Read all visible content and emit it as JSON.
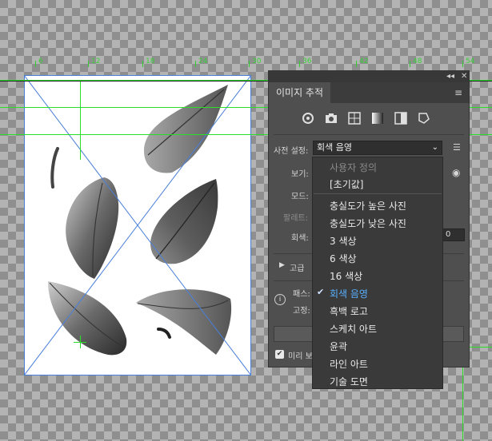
{
  "ruler": {
    "labels": [
      "6",
      "12",
      "18",
      "24",
      "30",
      "36",
      "42",
      "48",
      "54"
    ]
  },
  "panel": {
    "tab_title": "이미지 추적",
    "collapse_label": "◂◂",
    "close_label": "✕",
    "preset_label": "사전 설정:",
    "preset_value": "회색 음영",
    "view_label": "보기:",
    "mode_label": "모드:",
    "palette_label": "팔레트:",
    "grays_label": "회색:",
    "grays_value": "0",
    "advanced_label": "고급",
    "paths_label": "패스:",
    "fixed_label": "고정:",
    "preview_label": "미리 보기"
  },
  "dropdown": {
    "items": [
      {
        "label": "사용자 정의",
        "state": "disabled"
      },
      {
        "label": "[초기값]",
        "state": "normal"
      },
      {
        "label": "충실도가 높은 사진",
        "state": "normal"
      },
      {
        "label": "충실도가 낮은 사진",
        "state": "normal"
      },
      {
        "label": "3 색상",
        "state": "normal"
      },
      {
        "label": "6 색상",
        "state": "normal"
      },
      {
        "label": "16 색상",
        "state": "normal"
      },
      {
        "label": "회색 음영",
        "state": "selected"
      },
      {
        "label": "흑백 로고",
        "state": "normal"
      },
      {
        "label": "스케치 아트",
        "state": "normal"
      },
      {
        "label": "윤곽",
        "state": "normal"
      },
      {
        "label": "라인 아트",
        "state": "normal"
      },
      {
        "label": "기술 도면",
        "state": "normal"
      }
    ]
  },
  "icons": [
    "auto-color-icon",
    "camera-icon",
    "grid-icon",
    "grayscale-icon",
    "halves-icon",
    "shape-icon"
  ],
  "colors": {
    "guide": "#27e027",
    "artboard_border": "#4a7fd8",
    "panel_bg": "#4f4f4f",
    "dropdown_bg": "#3a3a3a",
    "selected": "#58b0ff"
  }
}
